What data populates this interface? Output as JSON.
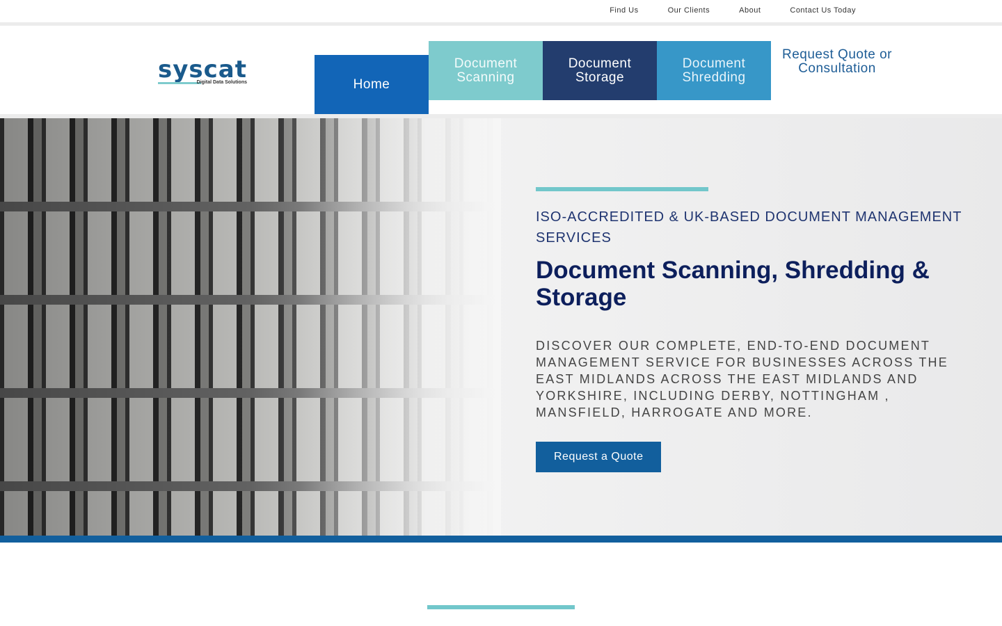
{
  "top_links": [
    "Find Us",
    "Our Clients",
    "About",
    "Contact Us Today"
  ],
  "logo": {
    "word": "syscat",
    "tagline": "Digital Data Solutions"
  },
  "nav": {
    "home": "Home",
    "scanning": "Document Scanning",
    "storage": "Document Storage",
    "shredding": "Document Shredding",
    "quote": "Request Quote or Consultation"
  },
  "hero": {
    "eyebrow": "ISO-ACCREDITED & UK-BASED DOCUMENT MANAGEMENT SERVICES",
    "title": "Document Scanning, Shredding & Storage",
    "description": "DISCOVER OUR COMPLETE, END-TO-END DOCUMENT MANAGEMENT SERVICE FOR BUSINESSES ACROSS THE EAST MIDLANDS ACROSS THE EAST MIDLANDS AND YORKSHIRE, INCLUDING DERBY, NOTTINGHAM , MANSFIELD, HARROGATE AND MORE.",
    "cta": "Request a Quote"
  },
  "colors": {
    "accent": "#72c7cb",
    "brand": "#125f9d",
    "home": "#1265b7",
    "storage": "#233d6e",
    "shredding": "#3797c8",
    "title": "#0d1f5c"
  }
}
